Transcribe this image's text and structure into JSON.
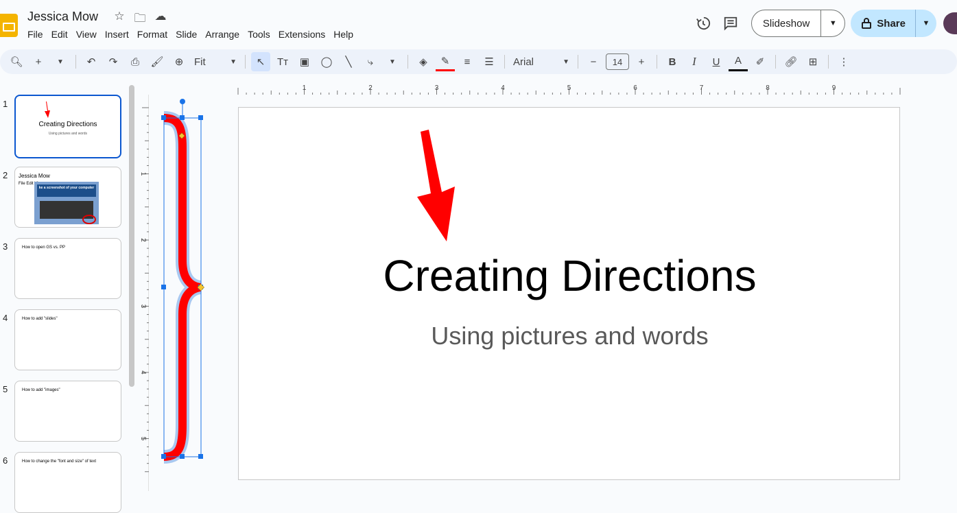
{
  "app": {
    "doc_title": "Jessica Mow",
    "menu": [
      "File",
      "Edit",
      "View",
      "Insert",
      "Format",
      "Slide",
      "Arrange",
      "Tools",
      "Extensions",
      "Help"
    ],
    "slideshow_label": "Slideshow",
    "share_label": "Share"
  },
  "toolbar": {
    "zoom_value": "Fit",
    "font_name": "Arial",
    "font_size": "14",
    "bold": "B",
    "italic": "I",
    "underline": "U",
    "text_color": "A"
  },
  "rulers": {
    "horizontal_labels": [
      "1",
      "2",
      "3",
      "4",
      "5",
      "6",
      "7",
      "8",
      "9"
    ],
    "vertical_labels": [
      "1",
      "2",
      "3",
      "4",
      "5"
    ]
  },
  "slide": {
    "title": "Creating Directions",
    "subtitle": "Using pictures and words"
  },
  "filmstrip": [
    {
      "number": "1",
      "title": "Creating Directions",
      "subtitle": "Using pictures and words"
    },
    {
      "number": "2",
      "title": "Jessica Mow",
      "menu": "File   Edit   View",
      "caption": "ke a screenshot of your computer"
    },
    {
      "number": "3",
      "title": "How to open GS vs. PP"
    },
    {
      "number": "4",
      "title": "How to add \"slides\""
    },
    {
      "number": "5",
      "title": "How to add \"images\""
    },
    {
      "number": "6",
      "title": "How to change the \"font and size\" of text"
    }
  ],
  "colors": {
    "accent": "#0b57d0",
    "shape_red": "#ff0000",
    "share_bg": "#c2e7ff"
  }
}
